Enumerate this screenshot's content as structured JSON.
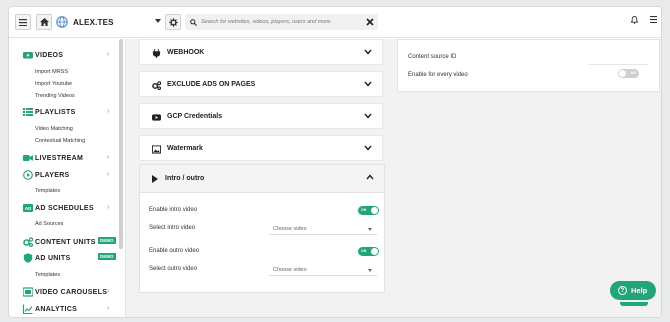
{
  "topbar": {
    "site_name": "ALEX.TES",
    "search_placeholder": "Search for websites, videos, players, users and more."
  },
  "sidebar": {
    "sections": [
      {
        "label": "VIDEOS",
        "icon": "video-icon"
      },
      {
        "label": "PLAYLISTS",
        "icon": "list-icon"
      },
      {
        "label": "LIVESTREAM",
        "icon": "camera-icon"
      },
      {
        "label": "PLAYERS",
        "icon": "play-circle-icon"
      },
      {
        "label": "AD SCHEDULES",
        "icon": "ad-icon"
      },
      {
        "label": "CONTENT UNITS",
        "icon": "cogs-icon",
        "badge": "DEMO"
      },
      {
        "label": "AD UNITS",
        "icon": "shield-icon",
        "badge": "DEMO"
      },
      {
        "label": "VIDEO CAROUSELS",
        "icon": "carousel-icon"
      },
      {
        "label": "ANALYTICS",
        "icon": "chart-icon"
      }
    ],
    "video_subitems": [
      "Import MRSS",
      "Import Youtube",
      "Trending Videos"
    ],
    "playlist_subitems": [
      "Video Matching",
      "Contextual Matching"
    ],
    "player_subitems": [
      "Templates"
    ],
    "adschedule_subitems": [
      "Ad Sources"
    ],
    "adunit_subitems": [
      "Templates"
    ]
  },
  "accordions": [
    {
      "label": "WEBHOOK",
      "icon": "webhook-icon"
    },
    {
      "label": "EXCLUDE ADS ON PAGES",
      "icon": "cogs-icon"
    },
    {
      "label": "GCP Credentials",
      "icon": "youtube-icon"
    },
    {
      "label": "Watermark",
      "icon": "image-icon"
    }
  ],
  "intro_outro": {
    "title": "Intro / outro",
    "enable_intro_label": "Enable intro video",
    "select_intro_label": "Select intro video",
    "enable_outro_label": "Enable outro video",
    "select_outro_label": "Select outro video",
    "select_placeholder": "Choose video",
    "toggle_on_text": "ON",
    "intro_enabled": true,
    "outro_enabled": true
  },
  "right_card": {
    "content_source_label": "Content source ID",
    "enable_every_label": "Enable for every video",
    "toggle_off_text": "NO",
    "enabled": false
  },
  "help": {
    "label": "Help"
  },
  "colors": {
    "accent": "#21a67a"
  }
}
